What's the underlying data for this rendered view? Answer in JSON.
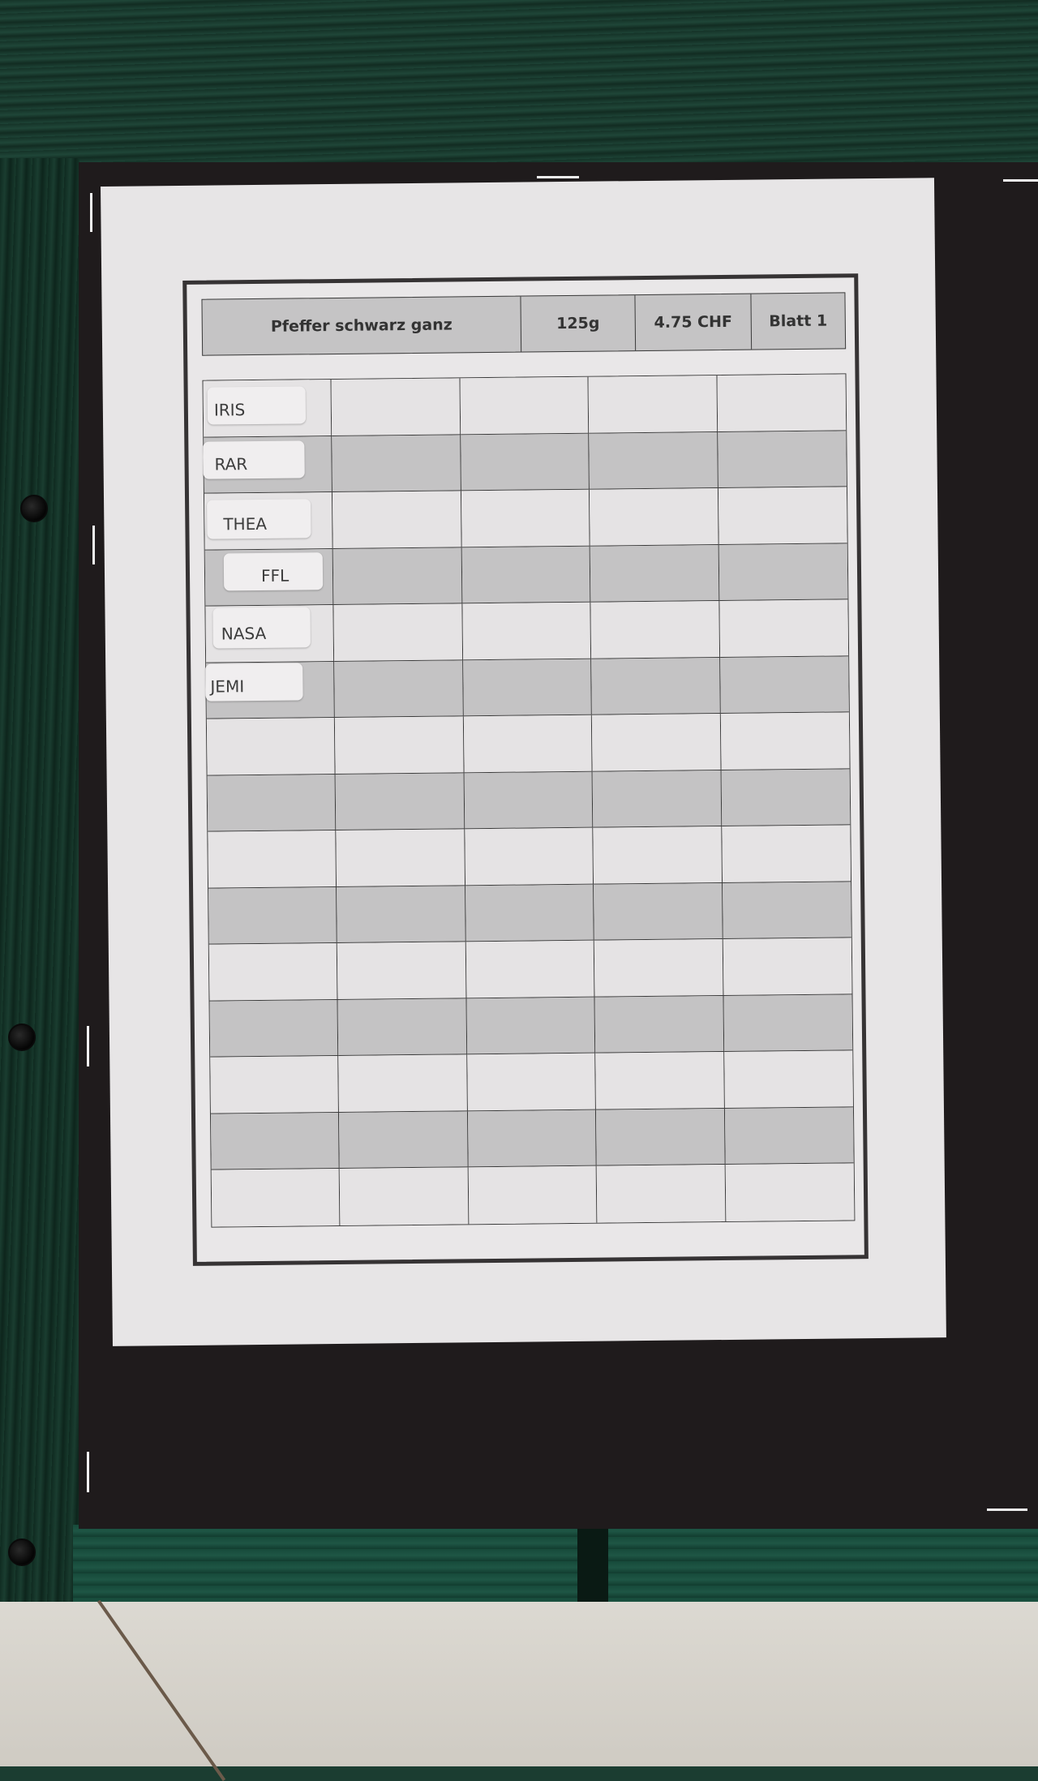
{
  "sheet": {
    "product": "Pfeffer schwarz ganz",
    "weight": "125g",
    "price": "4.75 CHF",
    "page": "Blatt 1"
  },
  "names": [
    "IRIS",
    "RAR",
    "THEA",
    "FFL",
    "NASA",
    "JEMI"
  ],
  "grid": {
    "rows": 15,
    "columns": 5
  },
  "colors": {
    "board": "#1b3d31",
    "mount": "#1f1b1c",
    "paper": "#e7e5e6",
    "row_light": "#e5e3e4",
    "row_dark": "#c4c3c4"
  }
}
